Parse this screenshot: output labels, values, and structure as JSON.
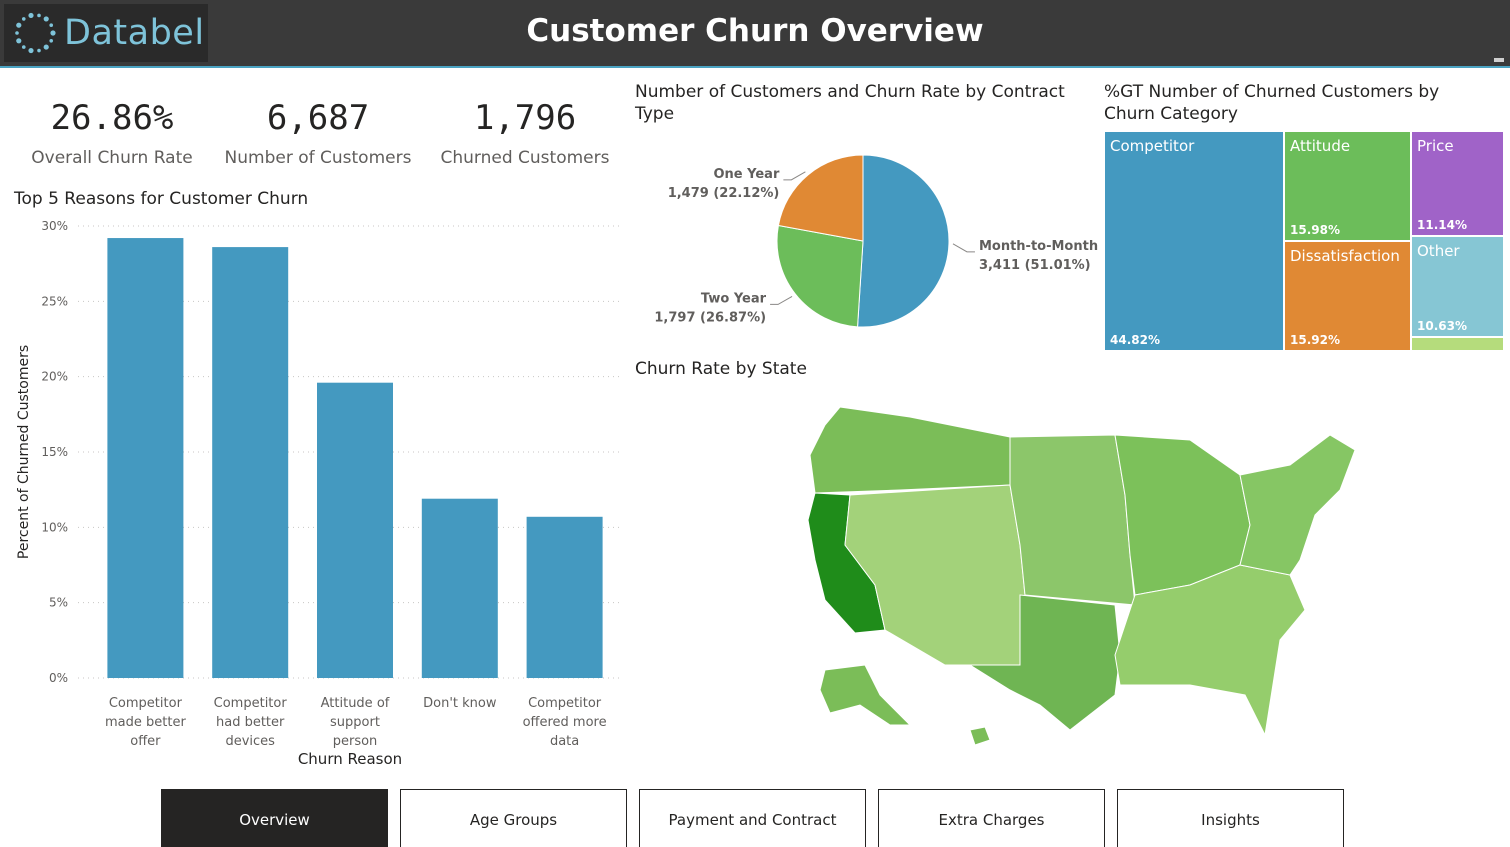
{
  "header": {
    "logo_text": "Databel",
    "title": "Customer Churn Overview"
  },
  "kpis": [
    {
      "value": "26.86%",
      "label": "Overall Churn Rate"
    },
    {
      "value": "6,687",
      "label": "Number of Customers"
    },
    {
      "value": "1,796",
      "label": "Churned Customers"
    }
  ],
  "visual_titles": {
    "bar": "Top 5 Reasons for Customer Churn",
    "pie_line1": "Number of Customers and Churn Rate by Contract",
    "pie_line2": "Type",
    "treemap_line1": "%GT Number of Churned Customers by",
    "treemap_line2": "Churn Category",
    "map": "Churn Rate by State"
  },
  "colors": {
    "accent": "#4499c0",
    "header_bg": "#3a3a3a",
    "orange": "#e08934",
    "green": "#6cbd5a",
    "purple": "#a063c8",
    "light_blue": "#86c6d4",
    "light_green": "#b5dc7c",
    "dark_green": "#148c14"
  },
  "chart_data": [
    {
      "type": "bar",
      "title": "Top 5 Reasons for Customer Churn",
      "xlabel": "Churn Reason",
      "ylabel": "Percent of Churned Customers",
      "categories": [
        [
          "Competitor",
          "made better",
          "offer"
        ],
        [
          "Competitor",
          "had better",
          "devices"
        ],
        [
          "Attitude of",
          "support",
          "person"
        ],
        [
          "Don't know"
        ],
        [
          "Competitor",
          "offered more",
          "data"
        ]
      ],
      "values": [
        29.2,
        28.6,
        19.6,
        11.9,
        10.7
      ],
      "yticks": [
        "0%",
        "5%",
        "10%",
        "15%",
        "20%",
        "25%",
        "30%"
      ],
      "ylim": [
        0,
        30
      ],
      "grid": true
    },
    {
      "type": "pie",
      "title": "Number of Customers and Churn Rate by Contract Type",
      "slices": [
        {
          "label": "Month-to-Month",
          "detail": "3,411 (51.01%)",
          "value": 3411,
          "color": "#4499c0"
        },
        {
          "label": "Two Year",
          "detail": "1,797 (26.87%)",
          "value": 1797,
          "color": "#6cbd5a"
        },
        {
          "label": "One Year",
          "detail": "1,479 (22.12%)",
          "value": 1479,
          "color": "#e08934"
        }
      ]
    },
    {
      "type": "treemap",
      "title": "%GT Number of Churned Customers by Churn Category",
      "items": [
        {
          "name": "Competitor",
          "value": "44.82%",
          "color": "#4499c0"
        },
        {
          "name": "Attitude",
          "value": "15.98%",
          "color": "#6cbd5a"
        },
        {
          "name": "Dissatisfaction",
          "value": "15.92%",
          "color": "#e08934"
        },
        {
          "name": "Price",
          "value": "11.14%",
          "color": "#a063c8"
        },
        {
          "name": "Other",
          "value": "10.63%",
          "color": "#86c6d4"
        },
        {
          "name": "",
          "value": "",
          "color": "#b5dc7c"
        }
      ]
    }
  ],
  "nav": [
    {
      "label": "Overview",
      "active": true
    },
    {
      "label": "Age Groups",
      "active": false
    },
    {
      "label": "Payment and Contract",
      "active": false
    },
    {
      "label": "Extra Charges",
      "active": false
    },
    {
      "label": "Insights",
      "active": false
    }
  ]
}
